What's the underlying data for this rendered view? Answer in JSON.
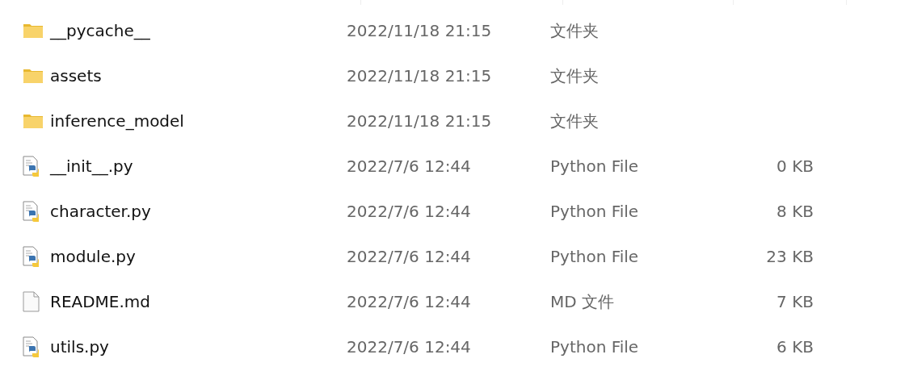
{
  "files": [
    {
      "kind": "folder",
      "name": "__pycache__",
      "modified": "2022/11/18 21:15",
      "type": "文件夹"
    },
    {
      "kind": "folder",
      "name": "assets",
      "modified": "2022/11/18 21:15",
      "type": "文件夹"
    },
    {
      "kind": "folder",
      "name": "inference_model",
      "modified": "2022/11/18 21:15",
      "type": "文件夹"
    },
    {
      "kind": "python",
      "name": "__init__.py",
      "modified": "2022/7/6 12:44",
      "type": "Python File",
      "size": "0 KB"
    },
    {
      "kind": "python",
      "name": "character.py",
      "modified": "2022/7/6 12:44",
      "type": "Python File",
      "size": "8 KB"
    },
    {
      "kind": "python",
      "name": "module.py",
      "modified": "2022/7/6 12:44",
      "type": "Python File",
      "size": "23 KB"
    },
    {
      "kind": "file",
      "name": "README.md",
      "modified": "2022/7/6 12:44",
      "type": "MD 文件",
      "size": "7 KB"
    },
    {
      "kind": "python",
      "name": "utils.py",
      "modified": "2022/7/6 12:44",
      "type": "Python File",
      "size": "6 KB"
    }
  ]
}
